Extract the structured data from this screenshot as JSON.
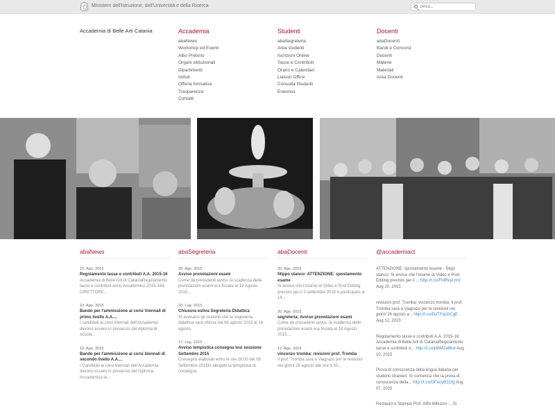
{
  "topbar": {
    "ministry": "Ministero dell'Istruzione, dell'Università e della Ricerca",
    "search_placeholder": "cerca..."
  },
  "brand": {
    "name": "Accademia di Belle Arti Catania"
  },
  "nav": [
    {
      "title": "Accademia",
      "links": [
        "abaNews",
        "Workshop ed Eventi",
        "Albo Pretorio",
        "Organi istituzionali",
        "Dipartimenti",
        "Istituti",
        "Offerta formativa",
        "Trasparenza",
        "Contatti"
      ]
    },
    {
      "title": "Studenti",
      "links": [
        "abaSegreteria",
        "Area studenti",
        "Iscrizioni Online",
        "Tasse e Contributi",
        "Orario e Calendari",
        "Liaison Office",
        "Consulta Studenti",
        "Erasmus"
      ]
    },
    {
      "title": "Docenti",
      "links": [
        "abaDocenti",
        "Bandi e Concorsi",
        "Docenti",
        "Materie",
        "Materiali",
        "Area Docenti"
      ]
    }
  ],
  "columns": {
    "abanews": {
      "heading": "abaNews",
      "posts": [
        {
          "date": "10. Ago. 2015",
          "title": "Regolamento tasse e contributi A.A. 2015-16",
          "body": "Accademia di Belle Arti di CataniaRegolamento tasse e contributi anno Accademico 2015-16IL DIRETTORE..."
        },
        {
          "date": "10. Ago. 2015",
          "title": "Bando per l'ammissione ai corsi triennali di primo livello A.A....",
          "body": "I candidati ai corsi triennali dell'Accademia devono essere in possesso del diploma di scuola..."
        },
        {
          "date": "10. Ago. 2015",
          "title": "Bando per l'ammissione ai corsi biennali di secondo livello A.A....",
          "body": "I Candidati ai corsi biennali dell'Accademia devono essere in possesso del Diploma Accademico di..."
        }
      ]
    },
    "abasegreteria": {
      "heading": "abaSegreteria",
      "posts": [
        {
          "date": "20. Ago. 2015",
          "title": "Avviso prenotazioni esami",
          "body": "Come da precedenti avvisi, la scadenza delle prenotazioni esami era fissata al 19 Agosto 2015...."
        },
        {
          "date": "20. Lug. 2015",
          "title": "Chiusura estiva Segreteria Didattica",
          "body": "Si avvisano gli studenti che la segreteria didattica sarà chiusa dal 06 agosto 2015 al 24 agosto."
        },
        {
          "date": "17. Lug. 2015",
          "title": "Avviso tempistica consegna tesi sessione Settembre 2015",
          "body": "Consegna elaborati entro le ore 16:00 del 08 Settembre 2015In allegato la tempistica di consegna."
        }
      ]
    },
    "abadocenti": {
      "heading": "abaDocenti",
      "posts": [
        {
          "date": "20. Ago. 2015",
          "title": "filippo stanco: ATTENZIONE: spostamento esame",
          "body": "Si avvisa che l'esame di Video e Post Editing previsto per il 3 settembre 2015 è posticipato al 14..."
        },
        {
          "date": "20. Ago. 2015",
          "title": "segreteria: Avviso prenotazioni esami",
          "body": "Come da precedenti avvisi, la scadenza delle prenotazioni esami era fissata al 19 Agosto 2015...."
        },
        {
          "date": "12. Ago. 2015",
          "title": "vincenzo tromba: revisioni prof. Tromba",
          "body": "Il prof. Tromba sarà a Viagrazo per le revisioni nei giorni 26 agosto alle ore 9.30..."
        }
      ]
    },
    "twitter": {
      "heading": "@accademiact",
      "tweets": [
        {
          "text": "ATTENZIONE: spostamento esame - Stigo stanco: Si avvisa che l'esame di Video e Post Editing previsto per il ...",
          "link": "http://t.co/FIdRvyLmV",
          "date": "Aug 20, 2015"
        },
        {
          "text": "revisioni prof. Tromba: vincenzo tromba: Il prof. Tromba sarà a Viagrazo per le revisioni nei giorni 26 agosto a...",
          "link": "http://t.co/DzTFqcGCgE",
          "date": "Aug 12, 2015"
        },
        {
          "text": "Regolamento tasse e contributi A.A. 2015-16: Accademia di Belle Arti di CataniaRegolamento tasse e contributi A...",
          "link": "http://t.co/p9WGeBrol",
          "date": "Aug 10, 2015"
        },
        {
          "text": "Prova di conoscenza della lingua italiana per studenti stranieri: Si comunica che la prova di conoscenza della...",
          "link": "http://t.co/OFecyB1Cfg",
          "date": "Aug 07, 2015"
        },
        {
          "text": "Restauro e Stampa Prof. Alfio Milluzzo ... Si",
          "link": "",
          "date": ""
        }
      ]
    }
  }
}
